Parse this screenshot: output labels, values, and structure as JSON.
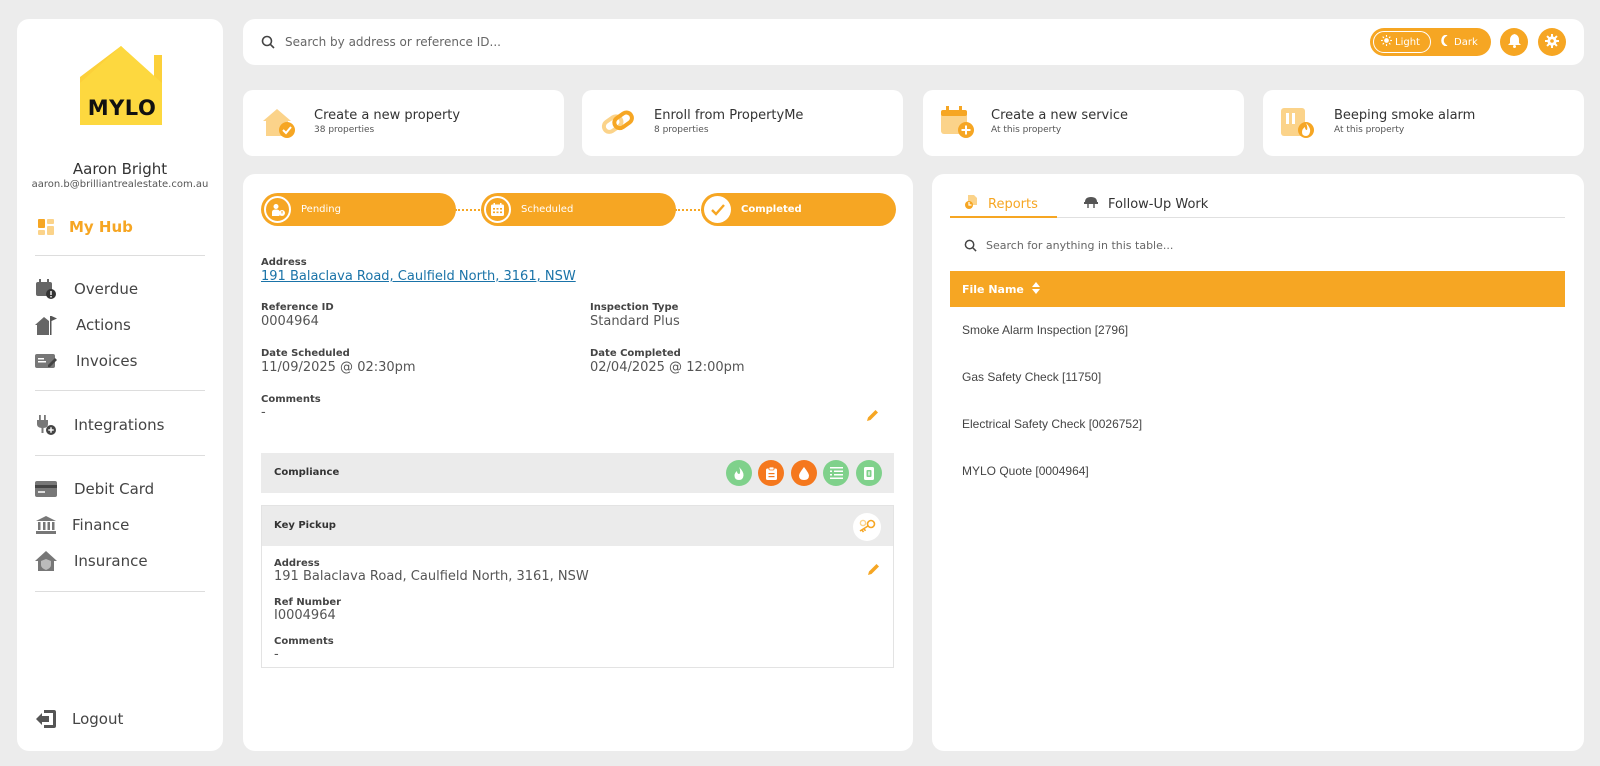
{
  "user": {
    "name": "Aaron Bright",
    "email": "aaron.b@brilliantrealestate.com.au"
  },
  "logo_text": "MYLO",
  "sidebar": {
    "items": [
      {
        "label": "My Hub",
        "icon": "hub-icon"
      },
      {
        "label": "Overdue",
        "icon": "calendar-alert-icon"
      },
      {
        "label": "Actions",
        "icon": "house-flag-icon"
      },
      {
        "label": "Invoices",
        "icon": "invoice-edit-icon"
      },
      {
        "label": "Integrations",
        "icon": "plug-add-icon"
      },
      {
        "label": "Debit Card",
        "icon": "credit-card-icon"
      },
      {
        "label": "Finance",
        "icon": "bank-icon"
      },
      {
        "label": "Insurance",
        "icon": "house-shield-icon"
      }
    ],
    "logout": "Logout"
  },
  "search": {
    "placeholder": "Search by address or reference ID..."
  },
  "theme": {
    "light": "Light",
    "dark": "Dark"
  },
  "quick_actions": [
    {
      "title": "Create a new property",
      "sub": "38 properties"
    },
    {
      "title": "Enroll from PropertyMe",
      "sub": "8 properties"
    },
    {
      "title": "Create a new service",
      "sub": "At this property"
    },
    {
      "title": "Beeping smoke alarm",
      "sub": "At this property"
    }
  ],
  "steps": [
    {
      "label": "Pending"
    },
    {
      "label": "Scheduled"
    },
    {
      "label": "Completed"
    }
  ],
  "details": {
    "address_label": "Address",
    "address": "191 Balaclava Road, Caulfield North, 3161, NSW",
    "ref_label": "Reference ID",
    "ref": "0004964",
    "type_label": "Inspection Type",
    "type": "Standard Plus",
    "scheduled_label": "Date Scheduled",
    "scheduled": "11/09/2025 @ 02:30pm",
    "completed_label": "Date Completed",
    "completed": "02/04/2025 @ 12:00pm",
    "comments_label": "Comments",
    "comments": "-"
  },
  "compliance": {
    "title": "Compliance",
    "badges": [
      "smoke-icon",
      "clipboard-icon",
      "water-drop-icon",
      "checklist-icon",
      "electrical-icon"
    ]
  },
  "key_pickup": {
    "title": "Key Pickup",
    "address_label": "Address",
    "address": "191 Balaclava Road, Caulfield North, 3161, NSW",
    "ref_label": "Ref Number",
    "ref": "I0004964",
    "comments_label": "Comments",
    "comments": "-"
  },
  "reports": {
    "tabs": [
      "Reports",
      "Follow-Up Work"
    ],
    "search_placeholder": "Search for anything in this table...",
    "column": "File Name",
    "rows": [
      "Smoke Alarm Inspection [2796]",
      "Gas Safety Check [11750]",
      "Electrical Safety Check [0026752]",
      "MYLO Quote [0004964]"
    ]
  },
  "colors": {
    "accent": "#f6a623",
    "green": "#7fd18b",
    "orange": "#f5781e",
    "link": "#1a73a8"
  }
}
